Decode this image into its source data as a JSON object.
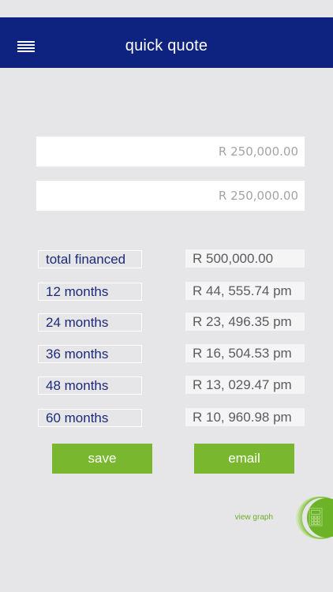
{
  "header": {
    "title": "quick quote"
  },
  "inputs": [
    {
      "value": "R 250,000.00"
    },
    {
      "value": "R 250,000.00"
    }
  ],
  "results": [
    {
      "label": "total financed",
      "value": "R 500,000.00"
    },
    {
      "label": "12 months",
      "value": "R 44, 555.74 pm"
    },
    {
      "label": "24 months",
      "value": "R 23, 496.35 pm"
    },
    {
      "label": "36 months",
      "value": "R 16, 504.53 pm"
    },
    {
      "label": "48 months",
      "value": "R 13, 029.47 pm"
    },
    {
      "label": "60 months",
      "value": "R 10, 960.98 pm"
    }
  ],
  "actions": {
    "save_label": "save",
    "email_label": "email"
  },
  "graph": {
    "label": "view graph",
    "icon": "calculator-icon"
  },
  "colors": {
    "header_blue": "#0e2380",
    "accent_green": "#78b72e",
    "background": "#e6e6e8",
    "label_text": "#1c2b78"
  }
}
